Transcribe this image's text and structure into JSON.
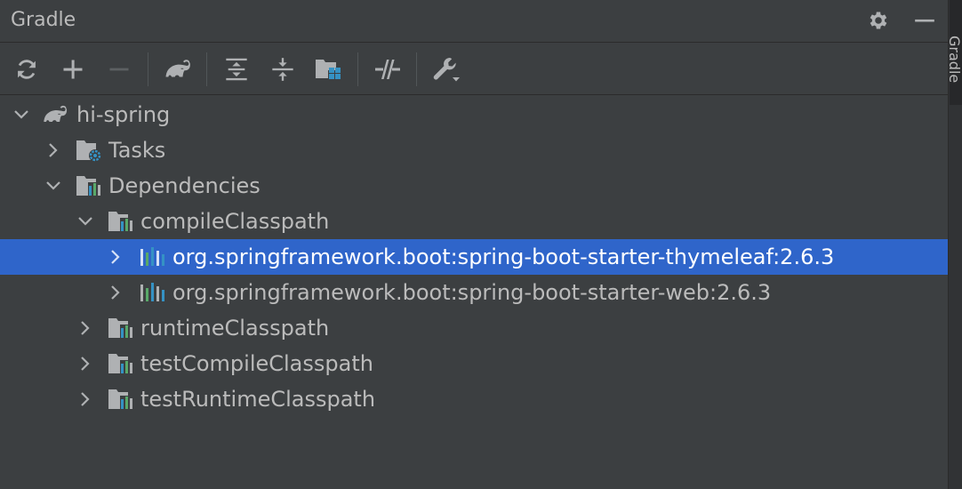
{
  "header": {
    "title": "Gradle",
    "settings_icon": "gear-icon",
    "minimize_icon": "minimize-icon"
  },
  "toolbar": {
    "buttons": [
      {
        "name": "reload-button",
        "icon": "refresh-icon"
      },
      {
        "name": "add-button",
        "icon": "plus-icon"
      },
      {
        "name": "remove-button",
        "icon": "minus-icon"
      },
      {
        "name": "execute-task-button",
        "icon": "gradle-elephant-icon"
      },
      {
        "name": "expand-all-button",
        "icon": "expand-all-icon"
      },
      {
        "name": "collapse-all-button",
        "icon": "collapse-all-icon"
      },
      {
        "name": "analyze-dependencies-button",
        "icon": "dependency-analyzer-icon"
      },
      {
        "name": "toggle-offline-button",
        "icon": "offline-mode-icon"
      },
      {
        "name": "build-settings-button",
        "icon": "wrench-icon"
      }
    ]
  },
  "tree": {
    "project": "hi-spring",
    "tasks": "Tasks",
    "dependencies": "Dependencies",
    "compile_classpath": "compileClasspath",
    "dep_thymeleaf": "org.springframework.boot:spring-boot-starter-thymeleaf:2.6.3",
    "dep_web": "org.springframework.boot:spring-boot-starter-web:2.6.3",
    "runtime_classpath": "runtimeClasspath",
    "test_compile_classpath": "testCompileClasspath",
    "test_runtime_classpath": "testRuntimeClasspath"
  },
  "side_strip": {
    "label": "Gradle"
  },
  "colors": {
    "panel_bg": "#3c3f41",
    "selection": "#2f65ca",
    "text": "#bbbbbb",
    "icon": "#afb1b3",
    "accent_blue": "#3592c4",
    "accent_green": "#59a869"
  }
}
